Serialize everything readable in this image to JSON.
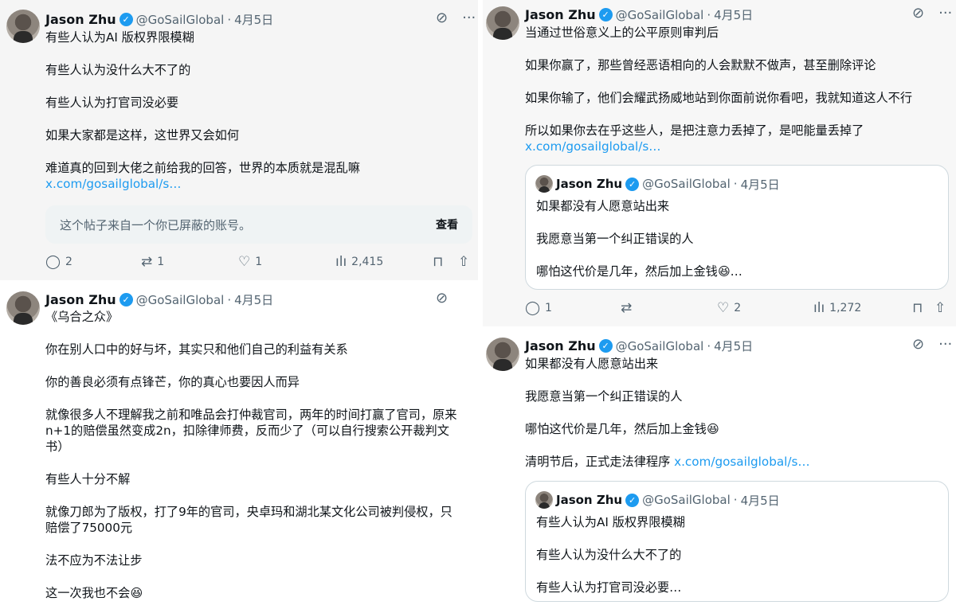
{
  "author": {
    "name": "Jason Zhu",
    "verified_mark": "✓",
    "handle": "@GoSailGlobal",
    "sep": "·",
    "date": "4月5日"
  },
  "icons": {
    "grok": "⊘",
    "more": "···",
    "reply": "◯",
    "repost": "⇄",
    "like": "♡",
    "views": "ılı",
    "bookmark": "⊓",
    "share": "⇧"
  },
  "post1": {
    "lines": [
      "有些人认为AI 版权界限模糊",
      "有些人认为没什么大不了的",
      "有些人认为打官司没必要",
      "如果大家都是这样，这世界又会如何",
      "难道真的回到大佬之前给我的回答，世界的本质就是混乱嘛"
    ],
    "link": "x.com/gosailglobal/s…",
    "blocked_text": "这个帖子来自一个你已屏蔽的账号。",
    "blocked_button": "查看",
    "replies": "2",
    "reposts": "1",
    "likes": "1",
    "views": "2,415"
  },
  "post2": {
    "lines": [
      "《乌合之众》",
      "你在别人口中的好与坏，其实只和他们自己的利益有关系",
      "你的善良必须有点锋芒，你的真心也要因人而异",
      "就像很多人不理解我之前和唯品会打仲裁官司，两年的时间打赢了官司，原来\nn+1的赔偿虽然变成2n，扣除律师费，反而少了（可以自行搜索公开裁判文\n书）",
      "有些人十分不解",
      "就像刀郎为了版权，打了9年的官司，央卓玛和湖北某文化公司被判侵权，只\n赔偿了75000元",
      "法不应为不法让步",
      "这一次我也不会😆"
    ]
  },
  "post3": {
    "lines": [
      "当通过世俗意义上的公平原则审判后",
      "如果你赢了，那些曾经恶语相向的人会默默不做声，甚至删除评论",
      "如果你输了，他们会耀武扬威地站到你面前说你看吧，我就知道这人不行",
      "所以如果你去在乎这些人，是把注意力丢掉了，是吧能量丢掉了"
    ],
    "link": "x.com/gosailglobal/s…",
    "quote_lines": [
      "如果都没有人愿意站出来",
      "我愿意当第一个纠正错误的人",
      "哪怕这代价是几年，然后加上金钱😆…"
    ],
    "replies": "1",
    "likes": "2",
    "views": "1,272"
  },
  "post4": {
    "lines": [
      "如果都没有人愿意站出来",
      "我愿意当第一个纠正错误的人",
      "哪怕这代价是几年，然后加上金钱😆"
    ],
    "last_line": "清明节后，正式走法律程序 ",
    "link": "x.com/gosailglobal/s…",
    "quote_lines": [
      "有些人认为AI 版权界限模糊",
      "有些人认为没什么大不了的",
      "有些人认为打官司没必要…"
    ]
  }
}
